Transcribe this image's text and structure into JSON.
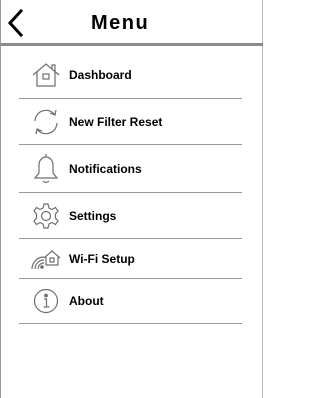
{
  "header": {
    "title": "Menu",
    "back_icon": "chevron-left-icon"
  },
  "menu": {
    "items": [
      {
        "label": "Dashboard",
        "icon": "home-icon"
      },
      {
        "label": "New Filter Reset",
        "icon": "refresh-icon"
      },
      {
        "label": "Notifications",
        "icon": "bell-icon"
      },
      {
        "label": "Settings",
        "icon": "gear-icon"
      },
      {
        "label": "Wi-Fi Setup",
        "icon": "wifi-home-icon"
      },
      {
        "label": "About",
        "icon": "info-icon"
      }
    ]
  },
  "colors": {
    "divider": "#9a9a9a",
    "icon_stroke": "#6e6e6e",
    "text": "#000000"
  }
}
